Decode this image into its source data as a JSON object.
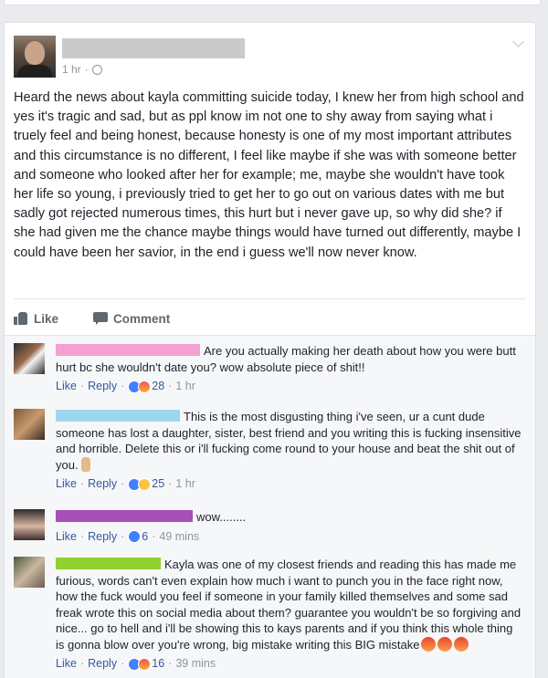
{
  "post": {
    "time": "1 hr",
    "text": "Heard the news about kayla committing suicide today, I knew her from high school and yes it's tragic and sad, but as ppl know im not one to shy away from saying what i truely feel and being honest, because honesty is one of my most important attributes and this circumstance is no different, I feel like maybe if she was with someone better and someone who looked after her for example; me, maybe she wouldn't have took her life so young, i previously tried to get her to go out on various dates with me but sadly got rejected numerous times, this hurt but i never gave up, so why did she? if she had given me the chance maybe things would have turned out differently, maybe I could have been her savior, in the end i guess we'll now never know.",
    "like_label": "Like",
    "comment_label": "Comment"
  },
  "comments": [
    {
      "redact_color": "#f5a0cf",
      "text": "Are you actually making her death about how you were butt hurt bc she wouldn't date you? wow absolute piece of shit!!",
      "like": "Like",
      "reply": "Reply",
      "count": "28",
      "time": "1 hr"
    },
    {
      "redact_color": "#9fd6ef",
      "text": "This is the most disgusting thing i've seen, ur a cunt dude someone has lost a daughter, sister, best friend and you writing this is fucking insensitive and horrible. Delete this or i'll fucking come round to your house and beat the shit out of you.",
      "like": "Like",
      "reply": "Reply",
      "count": "25",
      "time": "1 hr"
    },
    {
      "redact_color": "#a64fb8",
      "text": "wow........",
      "like": "Like",
      "reply": "Reply",
      "count": "6",
      "time": "49 mins"
    },
    {
      "redact_color": "#8fd12f",
      "text": "Kayla was one of my closest friends and reading this has made me furious, words can't even explain how much i want to punch you in the face right now, how the fuck would you feel if someone in your family killed themselves and some sad freak wrote this on social media about them? guarantee you wouldn't be so forgiving and nice... go to hell and i'll be showing this to kays parents and if you think this whole thing is gonna blow over you're wrong, big mistake writing this BIG mistake",
      "like": "Like",
      "reply": "Reply",
      "count": "16",
      "time": "39 mins"
    }
  ]
}
